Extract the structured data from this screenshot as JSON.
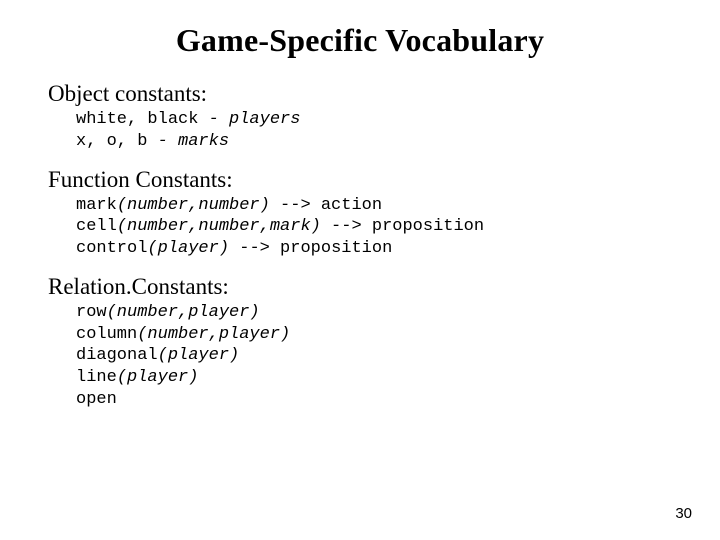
{
  "title": "Game-Specific Vocabulary",
  "sections": {
    "object": {
      "heading": "Object constants:",
      "line0_a": "white, black",
      "line0_b": " - players",
      "line1_a": "x, o, b",
      "line1_b": " - marks"
    },
    "function": {
      "heading": "Function Constants:",
      "line0_a": "mark",
      "line0_b": "(number,number)",
      "line0_c": " --> action",
      "line1_a": "cell",
      "line1_b": "(number,number,mark)",
      "line1_c": " --> proposition",
      "line2_a": "control",
      "line2_b": "(player)",
      "line2_c": " --> proposition"
    },
    "relation": {
      "heading": "Relation.Constants:",
      "line0_a": "row",
      "line0_b": "(number,player)",
      "line1_a": "column",
      "line1_b": "(number,player)",
      "line2_a": "diagonal",
      "line2_b": "(player)",
      "line3_a": "line",
      "line3_b": "(player)",
      "line4_a": "open"
    }
  },
  "page_number": "30"
}
